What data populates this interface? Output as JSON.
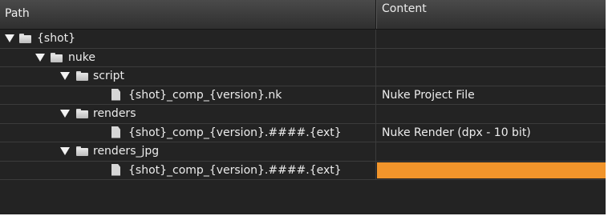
{
  "header": {
    "path_label": "Path",
    "content_label": "Content"
  },
  "colors": {
    "panel_bg": "#232323",
    "selection": "#f2952b",
    "text": "#ececec"
  },
  "tree": {
    "shot": {
      "label": "{shot}",
      "type": "folder",
      "expanded": true
    },
    "nuke": {
      "label": "nuke",
      "type": "folder",
      "expanded": true
    },
    "script": {
      "label": "script",
      "type": "folder",
      "expanded": true
    },
    "script_file": {
      "label": "{shot}_comp_{version}.nk",
      "type": "file",
      "content": "Nuke Project File"
    },
    "renders": {
      "label": "renders",
      "type": "folder",
      "expanded": true
    },
    "renders_file": {
      "label": "{shot}_comp_{version}.####.{ext}",
      "type": "file",
      "content": "Nuke Render (dpx - 10 bit)"
    },
    "renders_jpg": {
      "label": "renders_jpg",
      "type": "folder",
      "expanded": true
    },
    "renders_jpg_file": {
      "label": "{shot}_comp_{version}.####.{ext}",
      "type": "file",
      "content": ""
    }
  },
  "icons": {
    "expand": "triangle-down-icon",
    "folder": "folder-icon",
    "file": "file-icon"
  }
}
